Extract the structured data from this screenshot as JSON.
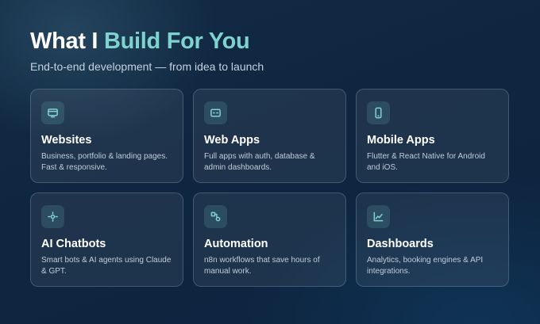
{
  "header": {
    "title_plain": "What I",
    "title_accent": "Build For You",
    "subtitle": "End-to-end development — from idea to launch"
  },
  "colors": {
    "accent": "#7fd3cf",
    "background": "#0f2640",
    "card_bg": "rgba(255,255,255,0.065)"
  },
  "services": [
    {
      "icon": "monitor-icon",
      "title": "Websites",
      "description": "Business, portfolio & landing pages. Fast & responsive."
    },
    {
      "icon": "app-window-icon",
      "title": "Web Apps",
      "description": "Full apps with auth, database & admin dashboards."
    },
    {
      "icon": "smartphone-icon",
      "title": "Mobile Apps",
      "description": "Flutter & React Native for Android and iOS."
    },
    {
      "icon": "sparkle-bot-icon",
      "title": "AI Chatbots",
      "description": "Smart bots & AI agents using Claude & GPT."
    },
    {
      "icon": "workflow-icon",
      "title": "Automation",
      "description": "n8n workflows that save hours of manual work."
    },
    {
      "icon": "chart-line-icon",
      "title": "Dashboards",
      "description": "Analytics, booking engines & API integrations."
    }
  ]
}
